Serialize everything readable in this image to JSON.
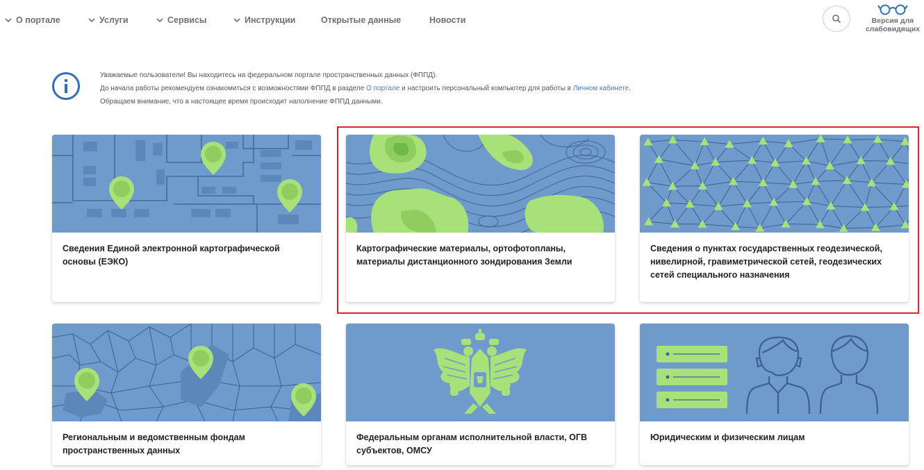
{
  "nav": {
    "items": [
      {
        "label": "О портале",
        "dropdown": true
      },
      {
        "label": "Услуги",
        "dropdown": true
      },
      {
        "label": "Сервисы",
        "dropdown": true
      },
      {
        "label": "Инструкции",
        "dropdown": true
      },
      {
        "label": "Открытые данные",
        "dropdown": false
      },
      {
        "label": "Новости",
        "dropdown": false
      }
    ],
    "search_icon": "search-icon",
    "vision_label_line1": "Версия для",
    "vision_label_line2": "слабовидящих"
  },
  "info": {
    "line1": "Уважаемые пользователи! Вы находитесь на федеральном портале пространственных данных (ФППД).",
    "line2_prefix": "До начала работы рекомендуем ознакомиться с возможностями ФППД в разделе ",
    "line2_link1": "О портале",
    "line2_middle": " и настроить персональный компьютер для работы в ",
    "line2_link2": "Личном кабинете",
    "line2_suffix": ".",
    "line3": "Обращаем внимание, что в настоящее время происходит наполнение ФППД данными."
  },
  "cards": [
    {
      "title": "Сведения Единой электронной картографической основы (ЕЭКО)"
    },
    {
      "title": "Картографические материалы, ортофотопланы, материалы дистанционного зондирования Земли"
    },
    {
      "title": "Сведения о пунктах государственных геодезической, нивелирной, гравиметрической сетей, геодезических сетей специального назначения"
    },
    {
      "title": "Региональным и ведомственным фондам пространственных данных"
    },
    {
      "title": "Федеральным органам исполнительной власти, ОГВ субъектов, ОМСУ"
    },
    {
      "title": "Юридическим и физическим лицам"
    }
  ],
  "colors": {
    "card_image_bg": "#6e9bcb",
    "accent_green": "#a8e07a",
    "highlight_border": "#e0222a",
    "link": "#4a7bc0"
  }
}
